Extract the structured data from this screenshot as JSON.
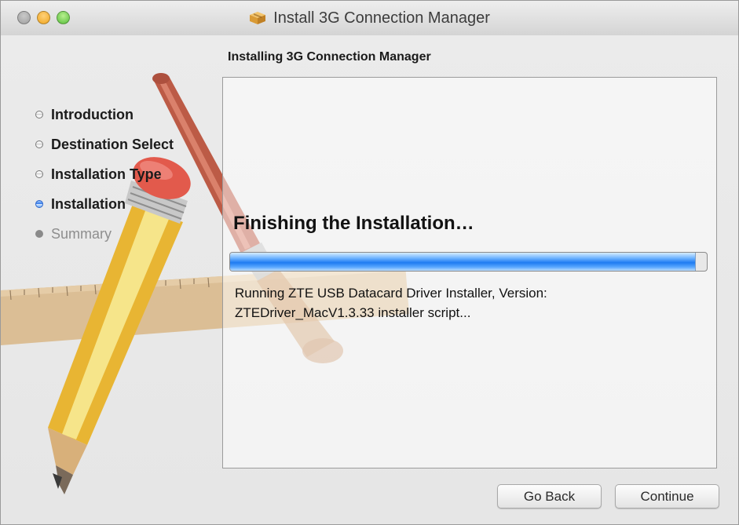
{
  "window": {
    "title": "Install 3G Connection Manager",
    "title_icon": "package-icon"
  },
  "heading": "Installing 3G Connection Manager",
  "steps": [
    {
      "label": "Introduction",
      "state": "done"
    },
    {
      "label": "Destination Select",
      "state": "done"
    },
    {
      "label": "Installation Type",
      "state": "done"
    },
    {
      "label": "Installation",
      "state": "active"
    },
    {
      "label": "Summary",
      "state": "future"
    }
  ],
  "panel": {
    "status": "Finishing the Installation…",
    "progress": 0.975,
    "detail_line1": "Running ZTE USB Datacard Driver Installer, Version:",
    "detail_line2": "ZTEDriver_MacV1.3.33 installer script..."
  },
  "buttons": {
    "back": "Go Back",
    "continue": "Continue"
  },
  "colors": {
    "accent": "#2e74e6",
    "traffic_close": "#b0b0b0",
    "traffic_minimize": "#f0a51e",
    "traffic_maximize": "#56bd3a"
  }
}
